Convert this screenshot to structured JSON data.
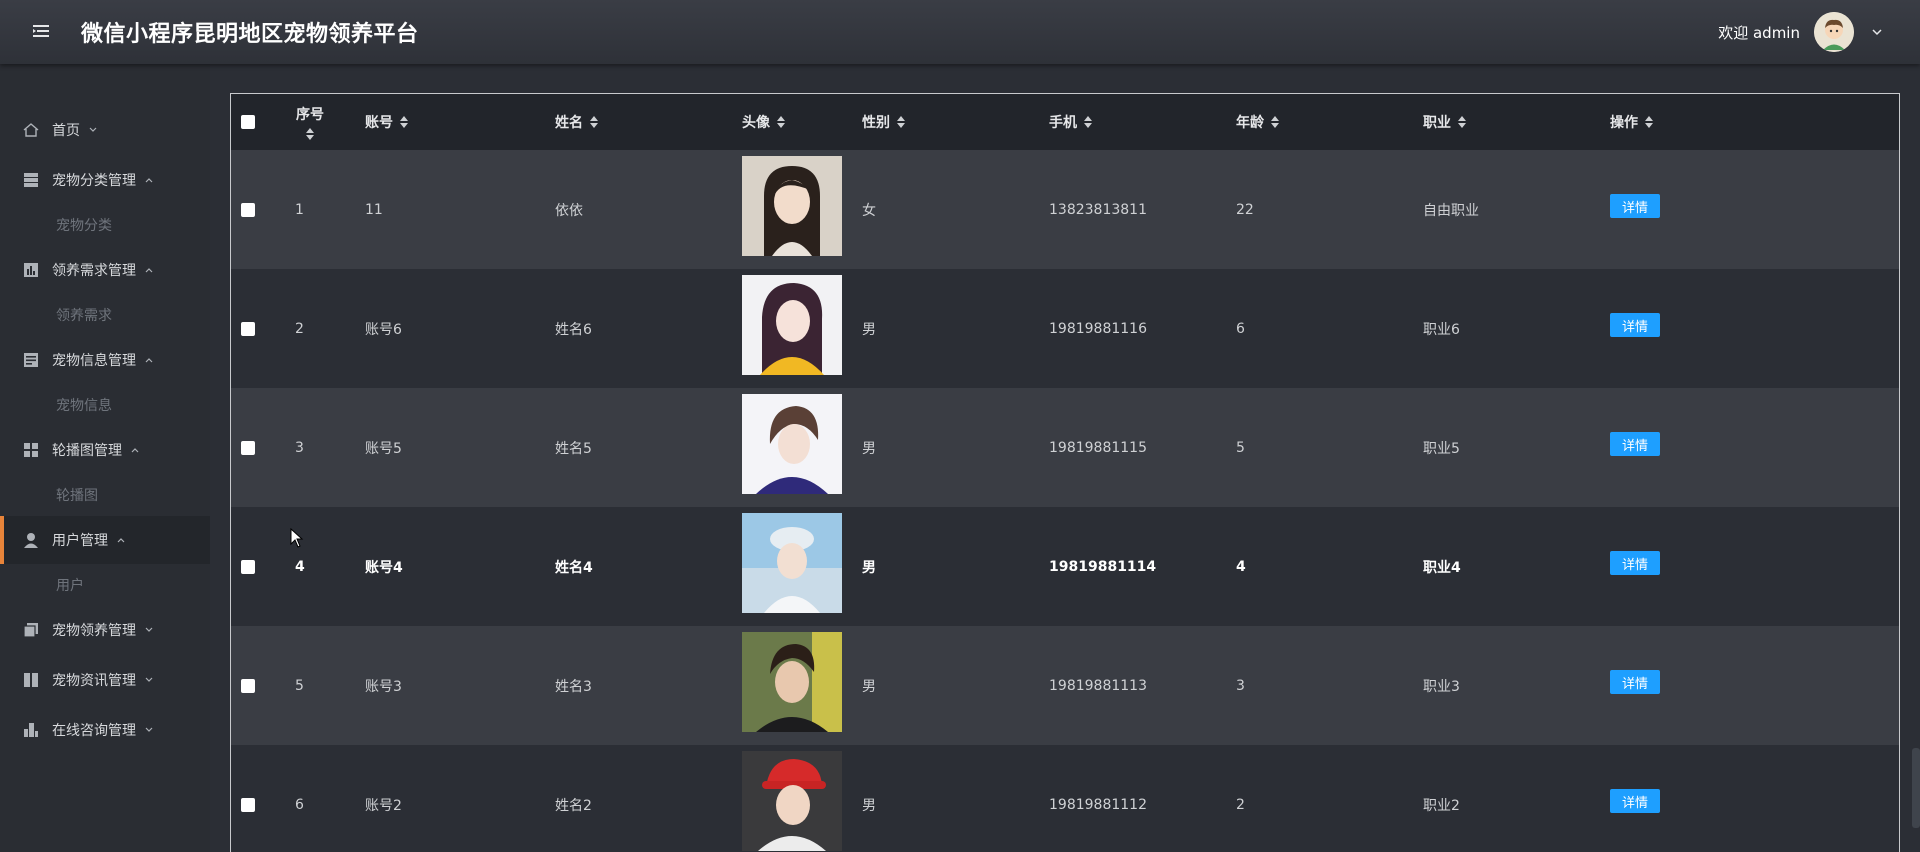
{
  "app": {
    "title": "微信小程序昆明地区宠物领养平台",
    "welcome": "欢迎 admin",
    "accent_color": "#e8843a",
    "button_color": "#1e9fff"
  },
  "sidebar": {
    "items": [
      {
        "label": "首页",
        "icon": "home-icon",
        "expanded": false
      },
      {
        "label": "宠物分类管理",
        "icon": "category-icon",
        "expanded": true,
        "sub": "宠物分类"
      },
      {
        "label": "领养需求管理",
        "icon": "chart-icon",
        "expanded": true,
        "sub": "领养需求"
      },
      {
        "label": "宠物信息管理",
        "icon": "info-icon",
        "expanded": true,
        "sub": "宠物信息"
      },
      {
        "label": "轮播图管理",
        "icon": "grid-icon",
        "expanded": true,
        "sub": "轮播图"
      },
      {
        "label": "用户管理",
        "icon": "user-icon",
        "expanded": true,
        "sub": "用户",
        "active": true
      },
      {
        "label": "宠物领养管理",
        "icon": "copy-icon",
        "expanded": false
      },
      {
        "label": "宠物资讯管理",
        "icon": "news-icon",
        "expanded": false
      },
      {
        "label": "在线咨询管理",
        "icon": "building-icon",
        "expanded": false
      }
    ]
  },
  "table": {
    "headers": {
      "index": "序号",
      "account": "账号",
      "name": "姓名",
      "avatar": "头像",
      "gender": "性别",
      "phone": "手机",
      "age": "年龄",
      "job": "职业",
      "action": "操作"
    },
    "detail_label": "详情",
    "rows": [
      {
        "index": "1",
        "account": "11",
        "name": "依依",
        "gender": "女",
        "phone": "13823813811",
        "age": "22",
        "job": "自由职业"
      },
      {
        "index": "2",
        "account": "账号6",
        "name": "姓名6",
        "gender": "男",
        "phone": "19819881116",
        "age": "6",
        "job": "职业6"
      },
      {
        "index": "3",
        "account": "账号5",
        "name": "姓名5",
        "gender": "男",
        "phone": "19819881115",
        "age": "5",
        "job": "职业5"
      },
      {
        "index": "4",
        "account": "账号4",
        "name": "姓名4",
        "gender": "男",
        "phone": "19819881114",
        "age": "4",
        "job": "职业4"
      },
      {
        "index": "5",
        "account": "账号3",
        "name": "姓名3",
        "gender": "男",
        "phone": "19819881113",
        "age": "3",
        "job": "职业3"
      },
      {
        "index": "6",
        "account": "账号2",
        "name": "姓名2",
        "gender": "男",
        "phone": "19819881112",
        "age": "2",
        "job": "职业2"
      }
    ]
  }
}
